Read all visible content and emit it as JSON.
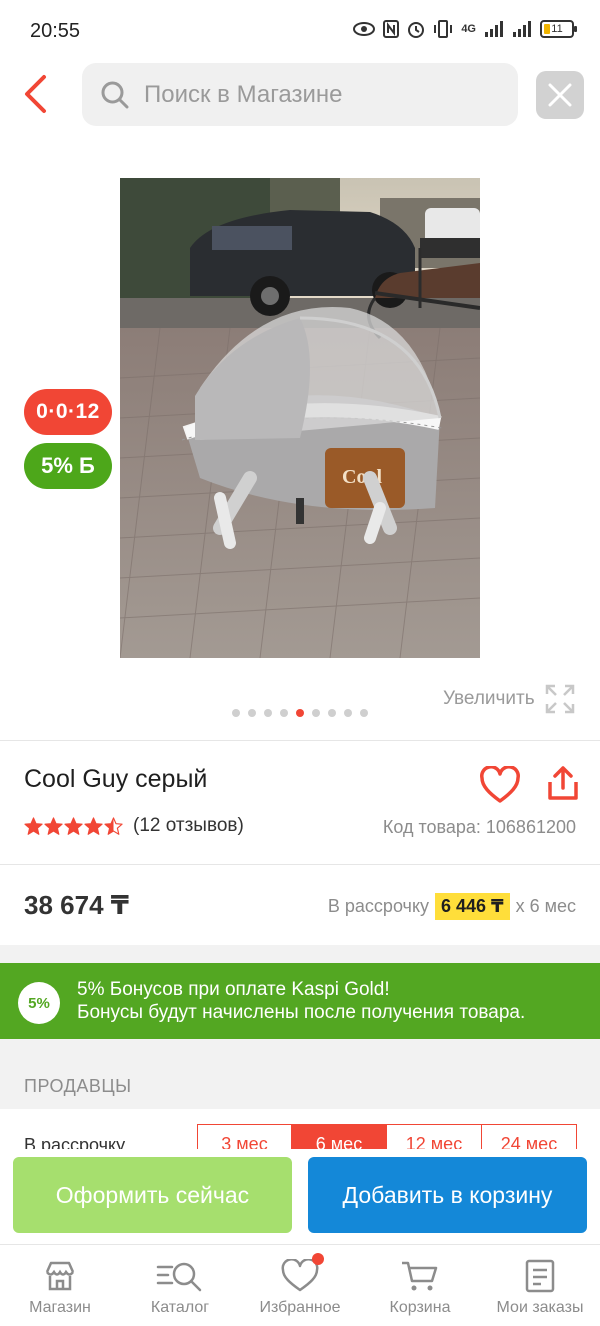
{
  "status_bar": {
    "time": "20:55",
    "net": "4G",
    "battery": "11"
  },
  "header": {
    "search_placeholder": "Поиск в Магазине"
  },
  "badges": {
    "installment": "0·0·12",
    "bonus": "5% Б"
  },
  "gallery": {
    "zoom_label": "Увеличить",
    "dots": 9,
    "active_dot": 4
  },
  "product": {
    "title": "Cool Guy серый",
    "rating": 4.5,
    "reviews": "(12 отзывов)",
    "code": "Код товара: 106861200",
    "price": "38 674 ₸",
    "installment_prefix": "В рассрочку",
    "installment_amount": "6 446 ₸",
    "installment_suffix": "х 6 мес"
  },
  "bonus": {
    "percent": "5%",
    "line1": "5% Бонусов при оплате Kaspi Gold!",
    "line2": "Бонусы будут начислены после получения товара."
  },
  "sellers": {
    "heading": "ПРОДАВЦЫ",
    "installment_label": "В рассрочку",
    "tabs": [
      "3 мес",
      "6 мес",
      "12 мес",
      "24 мес"
    ],
    "selected_tab": 1
  },
  "actions": {
    "buy_now": "Оформить сейчас",
    "add_to_cart": "Добавить в корзину"
  },
  "nav": [
    {
      "label": "Магазин",
      "icon": "shop-icon"
    },
    {
      "label": "Каталог",
      "icon": "catalog-icon"
    },
    {
      "label": "Избранное",
      "icon": "heart-icon"
    },
    {
      "label": "Корзина",
      "icon": "cart-icon"
    },
    {
      "label": "Мои заказы",
      "icon": "orders-icon"
    }
  ],
  "colors": {
    "accent_red": "#f14635",
    "bonus_green": "#53a722",
    "cart_blue": "#1488d8",
    "buy_now_green": "#a6df6e",
    "highlight_yellow": "#ffde3a"
  }
}
